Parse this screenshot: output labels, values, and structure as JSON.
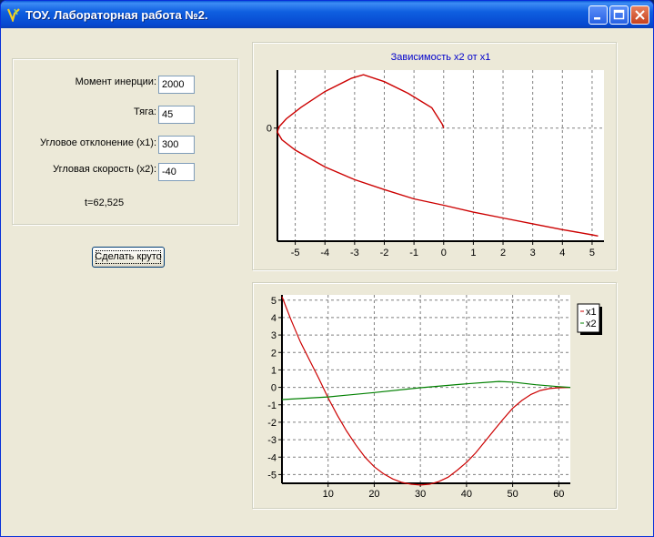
{
  "window": {
    "title": "ТОУ. Лабораторная работа №2.",
    "icon": "app-icon"
  },
  "form": {
    "inertia_label": "Момент инерции:",
    "inertia_value": "2000",
    "thrust_label": "Тяга:",
    "thrust_value": "45",
    "angle_label": "Угловое отклонение (x1):",
    "angle_value": "300",
    "speed_label": "Угловая скорость (x2):",
    "speed_value": "-40",
    "time_text": "t=62,525",
    "button_label": "Сделать круто"
  },
  "chart_data": [
    {
      "type": "line",
      "title": "Зависимость x2 от x1",
      "xlim": [
        -5.6,
        5.4
      ],
      "x_ticks": [
        -5,
        -4,
        -3,
        -2,
        -1,
        0,
        1,
        2,
        3,
        4,
        5
      ],
      "y_ticks": [
        0
      ],
      "grid": true,
      "series": [
        {
          "color": "#cc0000",
          "points": [
            [
              0,
              0
            ],
            [
              -0.05,
              0.07
            ],
            [
              -0.4,
              0.35
            ],
            [
              -1.2,
              0.6
            ],
            [
              -2.0,
              0.8
            ],
            [
              -2.7,
              0.92
            ],
            [
              -3.1,
              0.86
            ],
            [
              -4.0,
              0.63
            ],
            [
              -4.8,
              0.36
            ],
            [
              -5.3,
              0.16
            ],
            [
              -5.55,
              0.02
            ],
            [
              -5.6,
              -0.07
            ],
            [
              -5.45,
              -0.2
            ],
            [
              -5.0,
              -0.38
            ],
            [
              -4.0,
              -0.67
            ],
            [
              -3.0,
              -0.89
            ],
            [
              -2.0,
              -1.06
            ],
            [
              -1.0,
              -1.22
            ],
            [
              0,
              -1.33
            ],
            [
              1.0,
              -1.45
            ],
            [
              2.0,
              -1.55
            ],
            [
              3.0,
              -1.65
            ],
            [
              4.0,
              -1.75
            ],
            [
              5.0,
              -1.84
            ],
            [
              5.2,
              -1.86
            ]
          ]
        }
      ]
    },
    {
      "type": "line",
      "xlim": [
        0,
        62.5
      ],
      "ylim": [
        -5.5,
        5.3
      ],
      "x_ticks": [
        10,
        20,
        30,
        40,
        50,
        60
      ],
      "y_ticks": [
        5,
        4,
        3,
        2,
        1,
        0,
        -1,
        -2,
        -3,
        -4,
        -5
      ],
      "grid": true,
      "legend": "top-right",
      "series": [
        {
          "name": "x1",
          "color": "#cc0000",
          "points": [
            [
              0,
              5.2
            ],
            [
              2,
              3.85
            ],
            [
              4,
              2.6
            ],
            [
              6,
              1.55
            ],
            [
              8,
              0.5
            ],
            [
              10,
              -0.6
            ],
            [
              12,
              -1.6
            ],
            [
              14,
              -2.5
            ],
            [
              16,
              -3.3
            ],
            [
              18,
              -4.0
            ],
            [
              20,
              -4.55
            ],
            [
              22,
              -4.95
            ],
            [
              24,
              -5.25
            ],
            [
              26,
              -5.45
            ],
            [
              28,
              -5.55
            ],
            [
              30,
              -5.6
            ],
            [
              32,
              -5.55
            ],
            [
              34,
              -5.4
            ],
            [
              36,
              -5.15
            ],
            [
              38,
              -4.75
            ],
            [
              40,
              -4.3
            ],
            [
              42,
              -3.75
            ],
            [
              44,
              -3.1
            ],
            [
              46,
              -2.45
            ],
            [
              48,
              -1.8
            ],
            [
              50,
              -1.2
            ],
            [
              52,
              -0.75
            ],
            [
              54,
              -0.4
            ],
            [
              56,
              -0.18
            ],
            [
              58,
              -0.07
            ],
            [
              60,
              -0.02
            ],
            [
              62.5,
              0
            ]
          ]
        },
        {
          "name": "x2",
          "color": "#008000",
          "points": [
            [
              0,
              -0.7
            ],
            [
              10,
              -0.55
            ],
            [
              20,
              -0.3
            ],
            [
              30,
              -0.02
            ],
            [
              40,
              0.2
            ],
            [
              47,
              0.34
            ],
            [
              50,
              0.3
            ],
            [
              55,
              0.15
            ],
            [
              60,
              0.04
            ],
            [
              62.5,
              0
            ]
          ]
        }
      ]
    }
  ]
}
